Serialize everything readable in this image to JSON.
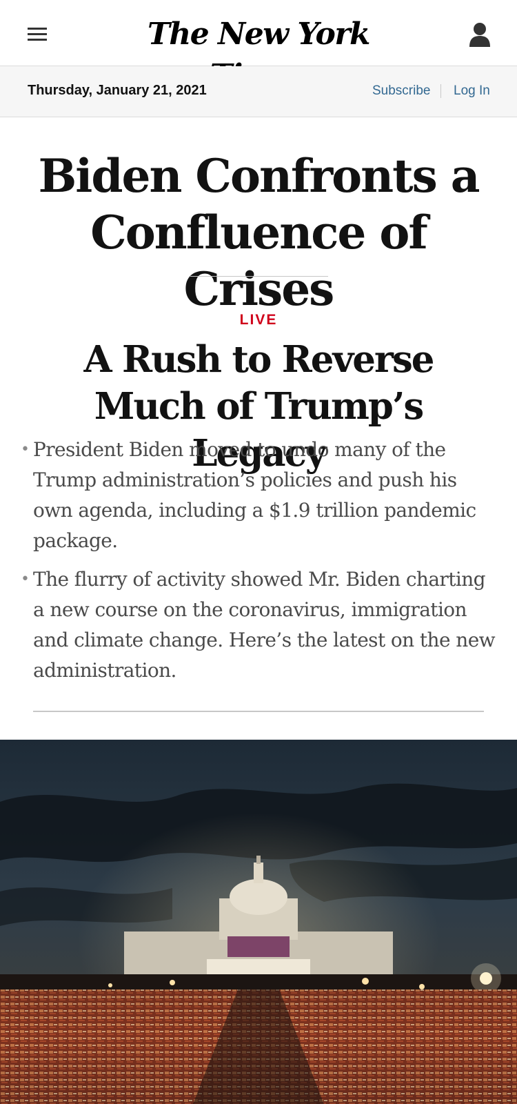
{
  "header": {
    "logo_text": "The New York Times",
    "menu_icon": "hamburger-menu-icon",
    "account_icon": "user-icon"
  },
  "date_bar": {
    "date": "Thursday, January 21, 2021",
    "subscribe_label": "Subscribe",
    "login_label": "Log In",
    "link_color": "#326891"
  },
  "lead": {
    "headline": "Biden Confronts a Confluence of Crises"
  },
  "story": {
    "live_label": "LIVE",
    "live_color": "#d0021b",
    "headline": "A Rush to Reverse Much of Trump’s Legacy",
    "summary": [
      "President Biden moved to undo many of the Trump administration’s policies and push his own agenda, including a $1.9 trillion pandemic package.",
      "The flurry of activity showed Mr. Biden charting a new course on the coronavirus, immigration and climate change. Here’s the latest on the new administration."
    ]
  }
}
